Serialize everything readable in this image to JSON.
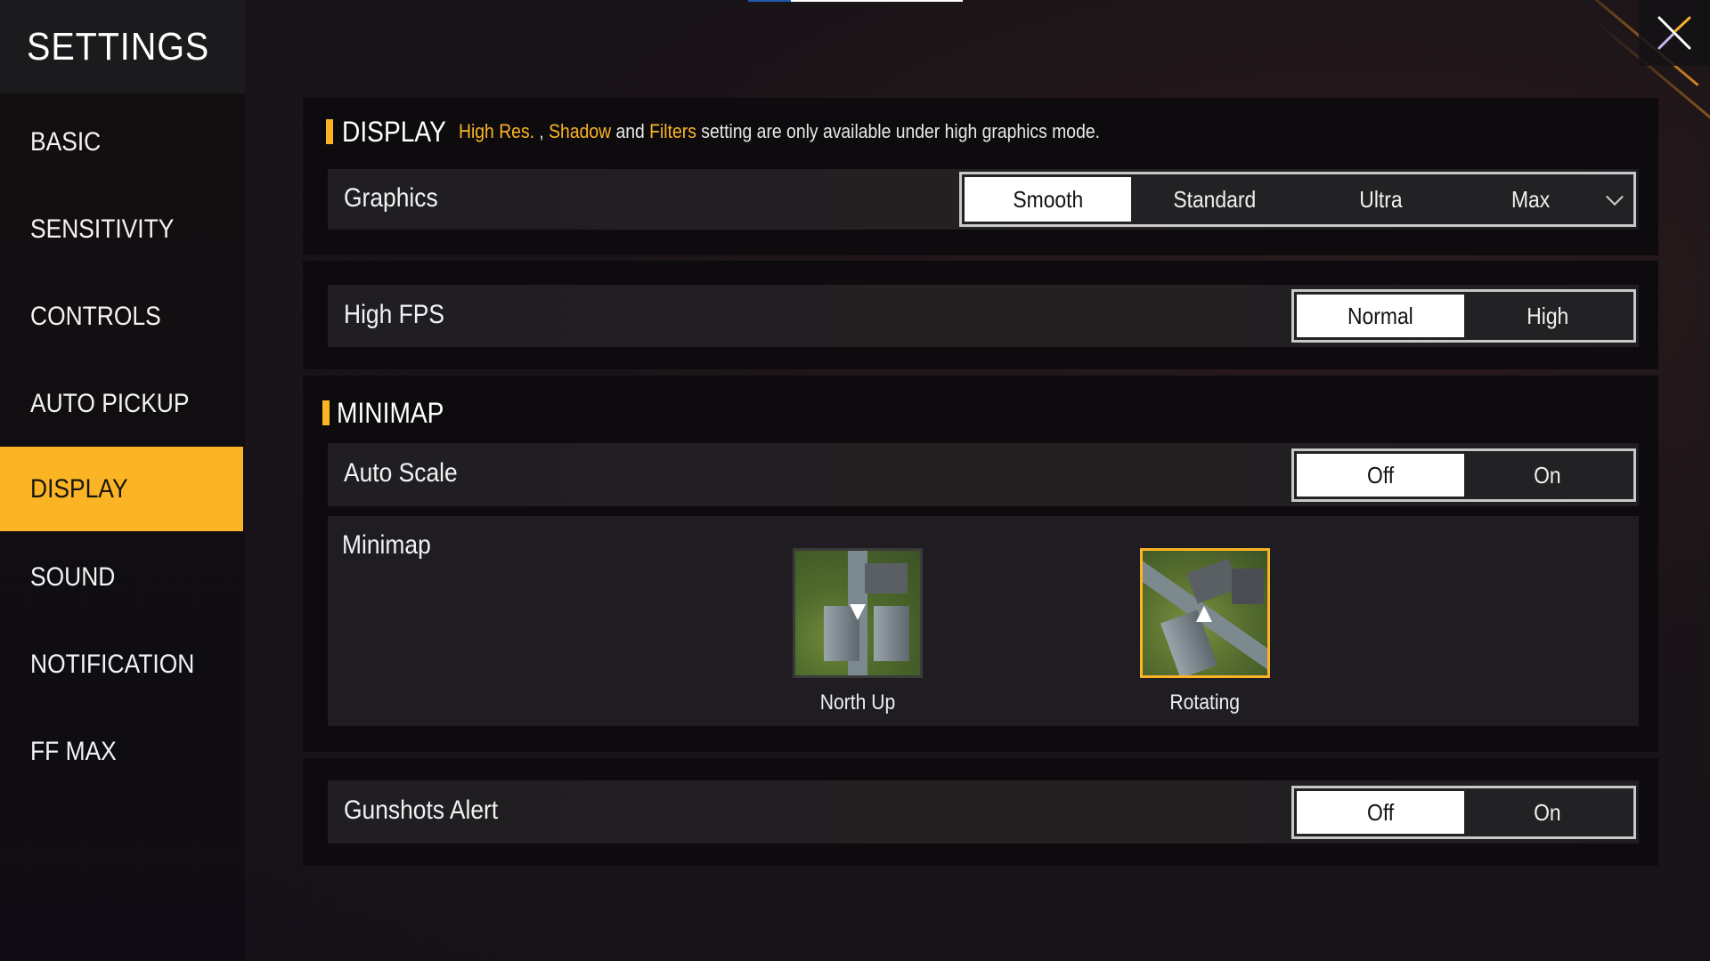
{
  "top_progress": {
    "fraction": 0.2
  },
  "sidebar": {
    "title": "SETTINGS",
    "items": [
      {
        "label": "BASIC",
        "active": false
      },
      {
        "label": "SENSITIVITY",
        "active": false
      },
      {
        "label": "CONTROLS",
        "active": false
      },
      {
        "label": "AUTO PICKUP",
        "active": false
      },
      {
        "label": "DISPLAY",
        "active": true
      },
      {
        "label": "SOUND",
        "active": false
      },
      {
        "label": "NOTIFICATION",
        "active": false
      },
      {
        "label": "FF MAX",
        "active": false
      }
    ]
  },
  "close_icon": "close-x-icon",
  "display": {
    "title": "DISPLAY",
    "notice": {
      "hl1": "High Res.",
      "sep1": " , ",
      "hl2": "Shadow",
      "mid": " and ",
      "hl3": "Filters",
      "tail": " setting are only available under high graphics mode."
    },
    "graphics": {
      "label": "Graphics",
      "options": [
        "Smooth",
        "Standard",
        "Ultra",
        "Max"
      ],
      "selected": "Smooth"
    },
    "high_fps": {
      "label": "High FPS",
      "options": [
        "Normal",
        "High"
      ],
      "selected": "Normal"
    }
  },
  "minimap": {
    "title": "MINIMAP",
    "auto_scale": {
      "label": "Auto Scale",
      "options": [
        "Off",
        "On"
      ],
      "selected": "Off"
    },
    "mode": {
      "label": "Minimap",
      "options": [
        "North Up",
        "Rotating"
      ],
      "selected": "Rotating"
    }
  },
  "gunshots_alert": {
    "label": "Gunshots Alert",
    "options": [
      "Off",
      "On"
    ],
    "selected": "Off"
  },
  "colors": {
    "accent": "#fbb524",
    "selected_option_bg": "#ffffff"
  }
}
